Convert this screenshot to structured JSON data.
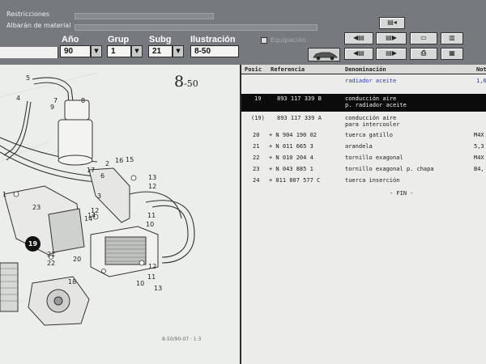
{
  "toolbar": {
    "restricciones_label": "Restricciones",
    "albaran_label": "Albarán de material",
    "ano_label": "Año",
    "grup_label": "Grup",
    "subg_label": "Subg",
    "ilustracion_label": "Ilustración",
    "ano_value": "90",
    "grup_value": "1",
    "subg_value": "21",
    "ilustracion_value": "8-50",
    "checkbox_label": "Equipación",
    "dropdown_arrow": "▼"
  },
  "diagram": {
    "page_number": "8",
    "page_suffix": "-50",
    "highlight_number": "19",
    "footer_code": "8-50/90-07 · 1·3",
    "callouts": [
      "5",
      "4",
      "8",
      "9",
      "7",
      "3",
      "2",
      "6",
      "17",
      "14",
      "16",
      "15",
      "13",
      "12",
      "1",
      "23",
      "12",
      "11",
      "14",
      "10",
      "19",
      "21",
      "20",
      "22",
      "18",
      "10",
      "11",
      "13",
      "12"
    ]
  },
  "list": {
    "headers": {
      "pos": "Posic",
      "ref": "Referencia",
      "den": "Denominación",
      "nota": "Not"
    },
    "rows": [
      {
        "pos": "",
        "ref": "",
        "den": "radiador aceite",
        "extra": "1,6",
        "state": "blue"
      },
      {
        "pos": "19",
        "ref": "893 117 339 B",
        "den": "conducción aire",
        "den2": "p. radiador aceite",
        "extra": "",
        "state": "selected"
      },
      {
        "pos": "(19)",
        "ref": "893 117 339 A",
        "den": "conducción aire",
        "den2": "para intercooler",
        "extra": "",
        "state": "normal"
      },
      {
        "pos": "20",
        "ref": "+ N    904 190 02",
        "den": "tuerca gatillo",
        "extra": "M4X",
        "state": "normal"
      },
      {
        "pos": "21",
        "ref": "+ N    011 665 3",
        "den": "arandela",
        "extra": "5,3",
        "state": "normal"
      },
      {
        "pos": "22",
        "ref": "+ N    010 204 4",
        "den": "tornillo exagonal",
        "extra": "M4X",
        "state": "normal"
      },
      {
        "pos": "23",
        "ref": "+ N    043 885 1",
        "den": "tornillo exagonal p. chapa",
        "extra": "B4,",
        "state": "normal"
      },
      {
        "pos": "24",
        "ref": "+ 811 807 577 C",
        "den": "tuerca inserción",
        "extra": "",
        "state": "normal"
      }
    ],
    "fin": "- FIN -"
  },
  "colors": {
    "toolbar_bg": "#767a7f",
    "selected_row_bg": "#0b0b0b",
    "blue_text": "#2f3fb8",
    "panel_bg": "#eceeec"
  },
  "icons": [
    "toolbar-list-icon",
    "toolbar-arrow-left-icon",
    "toolbar-arrow-right-icon",
    "printer-icon",
    "car-icon"
  ]
}
